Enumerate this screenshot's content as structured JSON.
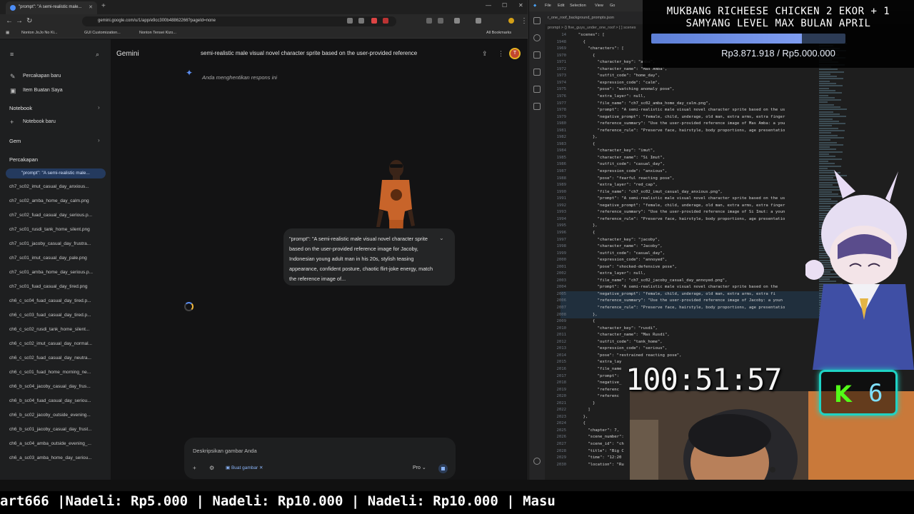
{
  "browser": {
    "tab_title": "\"prompt\": \"A semi-realistic male...",
    "url": "gemini.google.com/u/1/app/e9cc300b48862266?pageId=none",
    "bookmarks": [
      "Nonton JoJo No Ki...",
      "GUI Customization...",
      "Nonton Tensei Kizo..."
    ],
    "all_bookmarks": "All Bookmarks"
  },
  "gemini": {
    "brand": "Gemini",
    "conversation_title": "semi-realistic male visual novel character sprite based on the user-provided reference",
    "stopped_text": "Anda menghentikan respons ini",
    "prompt_bubble": "\"prompt\": \"A semi-realistic male visual novel character sprite based on the user-provided reference image for Jacoby, Indonesian young adult man in his 20s, stylish teasing appearance, confident posture, chaotic flirt-joke energy, match the reference image of...",
    "input_placeholder": "Deskripsikan gambar Anda",
    "buat_gambar": "Buat gambar",
    "model": "Pro",
    "avatar_letter": "T"
  },
  "sidebar": {
    "new_chat": "Percakapan baru",
    "my_items": "Item Buatan Saya",
    "notebook_head": "Notebook",
    "new_notebook": "Notebook baru",
    "gem_head": "Gem",
    "chats_head": "Percakapan",
    "chats": [
      "\"prompt\": \"A semi-realistic male...",
      "ch7_sc02_imut_casual_day_anxious...",
      "ch7_sc02_amba_home_day_calm.png",
      "ch7_sc02_fuad_casual_day_serious.p...",
      "ch7_sc01_rusdi_tank_home_silent.png",
      "ch7_sc01_jacoby_casual_day_frustra...",
      "ch7_sc01_imut_casual_day_pale.png",
      "ch7_sc01_amba_home_day_serious.p...",
      "ch7_sc01_fuad_casual_day_tired.png",
      "ch6_c_sc04_fuad_casual_day_tired.p...",
      "ch6_c_sc03_fuad_casual_day_tired.p...",
      "ch6_c_sc02_rusdi_tank_home_silent...",
      "ch6_c_sc02_imut_casual_day_normal...",
      "ch6_c_sc02_fuad_casual_day_neutra...",
      "ch6_c_sc01_fuad_home_morning_ne...",
      "ch6_b_sc04_jacoby_casual_day_frus...",
      "ch6_b_sc04_fuad_casual_day_seriou...",
      "ch6_b_sc02_jacoby_outside_evening...",
      "ch6_b_sc01_jacoby_casual_day_frust...",
      "ch6_a_sc04_amba_outside_evening_...",
      "ch6_a_sc03_amba_home_day_seriou..."
    ]
  },
  "vscode": {
    "menu": [
      "File",
      "Edit",
      "Selection",
      "View",
      "Go"
    ],
    "tab": "r_one_roof_background_prompts.json",
    "tab2": "five_guys_under_one",
    "breadcrumb": "prompt > {} five_guys_under_one_roof > [ ] scenes",
    "lines": [
      {
        "n": "14",
        "t": "  \"scenes\": ["
      },
      {
        "n": "1948",
        "t": "    {"
      },
      {
        "n": "1969",
        "t": "      \"characters\": ["
      },
      {
        "n": "1970",
        "t": "        {"
      },
      {
        "n": "1971",
        "t": "          \"character_key\": \"amba\","
      },
      {
        "n": "1972",
        "t": "          \"character_name\": \"Mas Amba\","
      },
      {
        "n": "1973",
        "t": "          \"outfit_code\": \"home_day\","
      },
      {
        "n": "1974",
        "t": "          \"expression_code\": \"calm\","
      },
      {
        "n": "1975",
        "t": "          \"pose\": \"watching anomaly pose\","
      },
      {
        "n": "1976",
        "t": "          \"extra_layer\": null,"
      },
      {
        "n": "1977",
        "t": "          \"file_name\": \"ch7_sc02_amba_home_day_calm.png\","
      },
      {
        "n": "1978",
        "t": "          \"prompt\": \"A semi-realistic male visual novel character sprite based on the us"
      },
      {
        "n": "1979",
        "t": "          \"negative_prompt\": \"female, child, underage, old man, extra arms, extra finger"
      },
      {
        "n": "1980",
        "t": "          \"reference_summary\": \"Use the user-provided reference image of Mas Amba: a you"
      },
      {
        "n": "1981",
        "t": "          \"reference_rule\": \"Preserve face, hairstyle, body proportions, age presentatio"
      },
      {
        "n": "1982",
        "t": "        },"
      },
      {
        "n": "1983",
        "t": "        {"
      },
      {
        "n": "1984",
        "t": "          \"character_key\": \"imut\","
      },
      {
        "n": "1985",
        "t": "          \"character_name\": \"Si Imut\","
      },
      {
        "n": "1986",
        "t": "          \"outfit_code\": \"casual_day\","
      },
      {
        "n": "1987",
        "t": "          \"expression_code\": \"anxious\","
      },
      {
        "n": "1988",
        "t": "          \"pose\": \"fearful reacting pose\","
      },
      {
        "n": "1989",
        "t": "          \"extra_layer\": \"red_cap\","
      },
      {
        "n": "1990",
        "t": "          \"file_name\": \"ch7_sc02_imut_casual_day_anxious.png\","
      },
      {
        "n": "1991",
        "t": "          \"prompt\": \"A semi-realistic male visual novel character sprite based on the us"
      },
      {
        "n": "1992",
        "t": "          \"negative_prompt\": \"female, child, underage, old man, extra arms, extra finger"
      },
      {
        "n": "1993",
        "t": "          \"reference_summary\": \"Use the user-provided reference image of Si Imut: a youn"
      },
      {
        "n": "1994",
        "t": "          \"reference_rule\": \"Preserve face, hairstyle, body proportions, age presentatio"
      },
      {
        "n": "1995",
        "t": "        },"
      },
      {
        "n": "1996",
        "t": "        {"
      },
      {
        "n": "1997",
        "t": "          \"character_key\": \"jacoby\","
      },
      {
        "n": "1998",
        "t": "          \"character_name\": \"Jacoby\","
      },
      {
        "n": "1999",
        "t": "          \"outfit_code\": \"casual_day\","
      },
      {
        "n": "2000",
        "t": "          \"expression_code\": \"annoyed\","
      },
      {
        "n": "2001",
        "t": "          \"pose\": \"shocked-defensive pose\","
      },
      {
        "n": "2002",
        "t": "          \"extra_layer\": null,"
      },
      {
        "n": "2003",
        "t": "          \"file_name\": \"ch7_sc02_jacoby_casual_day_annoyed.png\","
      },
      {
        "n": "2004",
        "t": "          \"prompt\": \"A semi-realistic male visual novel character sprite based on the"
      },
      {
        "n": "2005",
        "t": "          \"negative_prompt\": \"female, child, underage, old man, extra arms, extra fi"
      },
      {
        "n": "2006",
        "t": "          \"reference_summary\": \"Use the user-provided reference image of Jacoby: a youn"
      },
      {
        "n": "2007",
        "t": "          \"reference_rule\": \"Preserve face, hairstyle, body proportions, age presentatio"
      },
      {
        "n": "2008",
        "t": "        },"
      },
      {
        "n": "2009",
        "t": "        {"
      },
      {
        "n": "2010",
        "t": "          \"character_key\": \"rusdi\","
      },
      {
        "n": "2011",
        "t": "          \"character_name\": \"Mas Rusdi\","
      },
      {
        "n": "2012",
        "t": "          \"outfit_code\": \"tank_home\","
      },
      {
        "n": "2013",
        "t": "          \"expression_code\": \"serious\","
      },
      {
        "n": "2014",
        "t": "          \"pose\": \"restrained reacting pose\","
      },
      {
        "n": "2015",
        "t": "          \"extra_lay"
      },
      {
        "n": "2016",
        "t": "          \"file_name"
      },
      {
        "n": "2017",
        "t": "          \"prompt\":"
      },
      {
        "n": "2018",
        "t": "          \"negative_"
      },
      {
        "n": "2019",
        "t": "          \"referenc"
      },
      {
        "n": "2020",
        "t": "          \"referenc"
      },
      {
        "n": "2021",
        "t": "        }"
      },
      {
        "n": "2022",
        "t": "      ]"
      },
      {
        "n": "2023",
        "t": "    },"
      },
      {
        "n": "2024",
        "t": "    {"
      },
      {
        "n": "2025",
        "t": "      \"chapter\": 7,"
      },
      {
        "n": "2026",
        "t": "      \"scene_number\":"
      },
      {
        "n": "2027",
        "t": "      \"scene_id\": \"ch"
      },
      {
        "n": "2028",
        "t": "      \"title\": \"Big C"
      },
      {
        "n": "2029",
        "t": "      \"time\": \"12:20"
      },
      {
        "n": "2030",
        "t": "      \"location\": \"Ru"
      }
    ]
  },
  "overlay": {
    "goal_title_1": "MUKBANG RICHEESE CHICKEN 2 EKOR + 1",
    "goal_title_2": "SAMYANG LEVEL MAX BULAN APRIL",
    "goal_progress": 0.7744,
    "goal_amount": "Rp3.871.918 / Rp5.000.000",
    "timer": "100:51:57",
    "k_logo": "K",
    "k_count": "6",
    "ticker": "art666 |Nadeli: Rp5.000 | Nadeli: Rp10.000 | Nadeli: Rp10.000 | Masu"
  },
  "colors": {
    "accent_blue": "#8ab4f8",
    "kick_green": "#53fc18",
    "badge_cyan": "#1fd3c4"
  }
}
